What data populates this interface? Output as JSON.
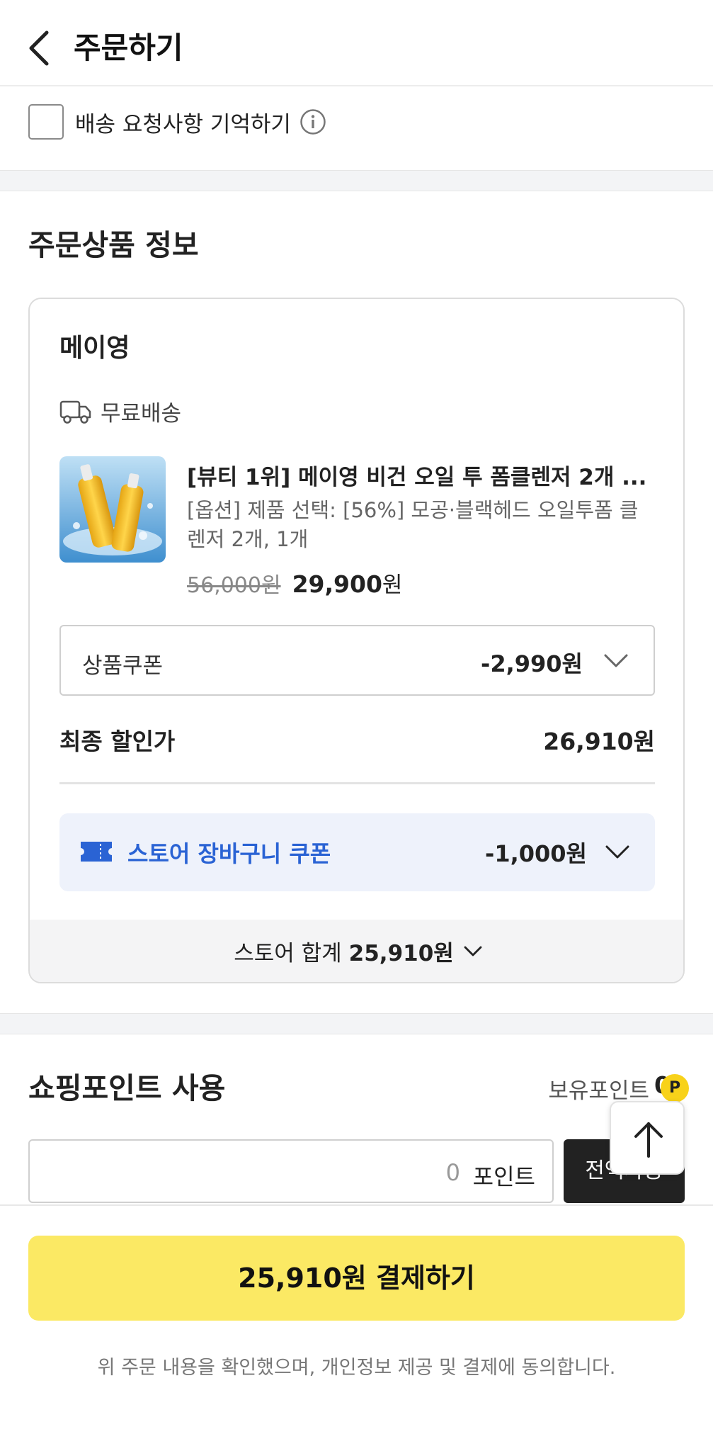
{
  "header": {
    "title": "주문하기",
    "back_icon": "chevron-left-icon"
  },
  "delivery_request": {
    "remember_label": "배송 요청사항 기억하기",
    "checked": false
  },
  "order_section": {
    "title": "주문상품 정보",
    "store": {
      "name": "메이영",
      "shipping_label": "무료배송",
      "product": {
        "name": "[뷰티 1위] 메이영 비건 오일 투 폼클렌저 2개 ...",
        "option": "[옵션] 제품 선택: [56%] 모공·블랙헤드 오일투폼 클렌저 2개, 1개",
        "original_price": "56,000원",
        "sale_price": "29,900",
        "sale_unit": "원"
      },
      "coupon": {
        "label": "상품쿠폰",
        "value": "-2,990원"
      },
      "final": {
        "label": "최종 할인가",
        "value": "26,910원"
      },
      "basket_coupon": {
        "label": "스토어 장바구니 쿠폰",
        "value": "-1,000원",
        "color": "#2a63d4"
      },
      "total": {
        "label": "스토어 합계",
        "amount": "25,910원"
      }
    }
  },
  "points_section": {
    "title": "쇼핑포인트 사용",
    "owned_label": "보유포인트",
    "owned_value": "0",
    "badge": "P",
    "input_value": "0",
    "input_unit": "포인트",
    "use_all_label": "전액사용"
  },
  "footer": {
    "pay_label": "25,910원 결제하기",
    "agree_text": "위 주문 내용을 확인했으며, 개인정보 제공 및 결제에 동의합니다.",
    "accent": "#fbe964"
  }
}
